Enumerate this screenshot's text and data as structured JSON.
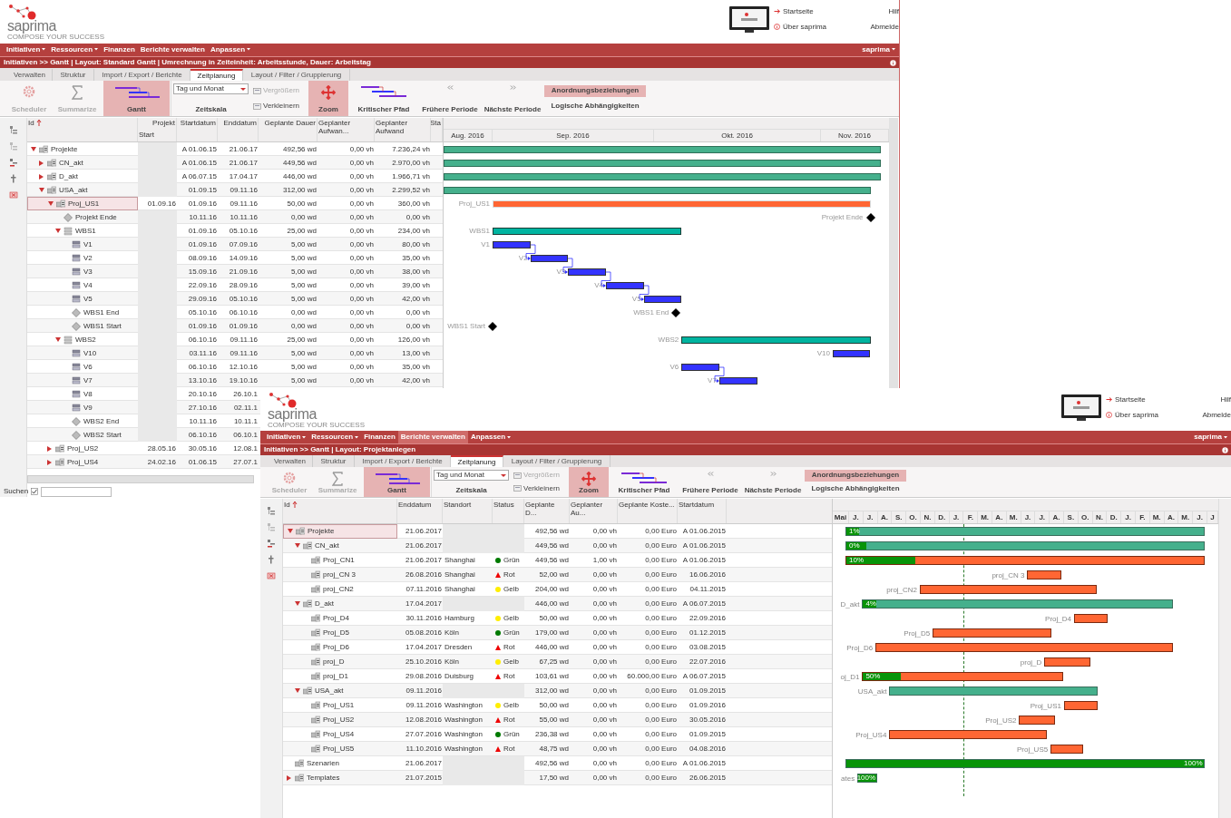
{
  "back_window": {
    "header": {
      "logo": {
        "name": "saprima",
        "tagline": "COMPOSE YOUR SUCCESS"
      },
      "links": [
        "Startseite",
        "Über saprima"
      ],
      "right_links": [
        "Hilf",
        "Abmelde"
      ]
    },
    "menu": [
      {
        "label": "Initiativen",
        "has_menu": true,
        "selected": false
      },
      {
        "label": "Ressourcen",
        "has_menu": true,
        "selected": false
      },
      {
        "label": "Finanzen",
        "has_menu": false,
        "selected": false
      },
      {
        "label": "Berichte verwalten",
        "has_menu": false,
        "selected": false
      },
      {
        "label": "Anpassen",
        "has_menu": true,
        "selected": false
      }
    ],
    "user_menu": "saprima",
    "breadcrumb": "Initiativen >> Gantt | Layout: Standard Gantt | Umrechnung in Zeiteinheit: Arbeitsstunde, Dauer: Arbeitstag",
    "tabs": [
      {
        "label": "Verwalten",
        "selected": false
      },
      {
        "label": "Struktur",
        "selected": false
      },
      {
        "label": "Import / Export / Berichte",
        "selected": false
      },
      {
        "label": "Zeitplanung",
        "selected": true
      },
      {
        "label": "Layout / Filter / Gruppierung",
        "selected": false
      }
    ],
    "ribbon": [
      {
        "kind": "large",
        "label": "Scheduler",
        "disabled": true,
        "selected": false
      },
      {
        "kind": "large",
        "label": "Summarize",
        "disabled": true,
        "selected": false
      },
      {
        "kind": "large",
        "label": "Gantt",
        "disabled": false,
        "selected": true
      },
      {
        "kind": "dropdown",
        "value": "Tag und Monat",
        "caption": "Zeitskala"
      },
      {
        "kind": "small_group",
        "buttons": [
          {
            "label": "Vergrößern",
            "disabled": true
          },
          {
            "label": "Verkleinern",
            "disabled": false
          }
        ]
      },
      {
        "kind": "large",
        "label": "Zoom",
        "disabled": false,
        "selected": true
      },
      {
        "kind": "large",
        "label": "Kritischer Pfad",
        "disabled": false,
        "selected": false
      },
      {
        "kind": "large",
        "label": "Frühere Periode",
        "disabled": false,
        "selected": false
      },
      {
        "kind": "large",
        "label": "Nächste Periode",
        "disabled": false,
        "selected": false
      },
      {
        "kind": "toggle_group",
        "buttons": [
          {
            "label": "Anordnungsbeziehungen",
            "selected": true
          },
          {
            "label": "Logische Abhängigkeiten",
            "selected": false
          }
        ]
      }
    ],
    "table": {
      "columns": [
        {
          "label": "Id",
          "sorted": true
        },
        {
          "label": "Projekt",
          "sublabel": "Start",
          "sorted": false
        },
        {
          "label": "Startdatum",
          "sorted": false
        },
        {
          "label": "Enddatum",
          "sorted": false
        },
        {
          "label": "Geplante Dauer",
          "sorted": false
        },
        {
          "label": "Geplanter Aufwan...",
          "sorted": false
        },
        {
          "label": "Geplanter Aufwand",
          "sorted": false
        },
        {
          "label": "Sta",
          "sorted": false
        }
      ],
      "rows": [
        {
          "name": "Projekte",
          "kind": "portfolio",
          "expanded": true,
          "selected": false,
          "start": "A 01.06.15",
          "end": "21.06.17",
          "duration": "492,56 wd",
          "effort_a": "0,00 vh",
          "effort_b": "7.236,24 vh",
          "children": [
            {
              "name": "CN_akt",
              "kind": "portfolio",
              "expanded": false,
              "selected": false,
              "start": "A 01.06.15",
              "end": "21.06.17",
              "duration": "449,56 wd",
              "effort_a": "0,00 vh",
              "effort_b": "2.970,00 vh"
            },
            {
              "name": "D_akt",
              "kind": "portfolio",
              "expanded": false,
              "selected": false,
              "start": "A 06.07.15",
              "end": "17.04.17",
              "duration": "446,00 wd",
              "effort_a": "0,00 vh",
              "effort_b": "1.966,71 vh"
            },
            {
              "name": "USA_akt",
              "kind": "portfolio",
              "expanded": true,
              "selected": false,
              "start": "01.09.15",
              "end": "09.11.16",
              "duration": "312,00 wd",
              "effort_a": "0,00 vh",
              "effort_b": "2.299,52 vh",
              "children": [
                {
                  "name": "Proj_US1",
                  "kind": "project",
                  "expanded": true,
                  "selected": true,
                  "bar_label": "Proj_US1",
                  "project_start": "01.09.16",
                  "start": "01.09.16",
                  "end": "09.11.16",
                  "duration": "50,00 wd",
                  "effort_a": "0,00 vh",
                  "effort_b": "360,00 vh",
                  "children": [
                    {
                      "name": "Projekt Ende",
                      "kind": "milestone",
                      "selected": false,
                      "bar_label": "Projekt Ende",
                      "start": "10.11.16",
                      "end": "10.11.16",
                      "duration": "0,00 wd",
                      "effort_a": "0,00 vh",
                      "effort_b": "0,00 vh"
                    },
                    {
                      "name": "WBS1",
                      "kind": "wbs",
                      "expanded": true,
                      "selected": false,
                      "bar_label": "WBS1",
                      "start": "01.09.16",
                      "end": "05.10.16",
                      "duration": "25,00 wd",
                      "effort_a": "0,00 vh",
                      "effort_b": "234,00 vh",
                      "children": [
                        {
                          "name": "V1",
                          "kind": "task",
                          "selected": false,
                          "bar_label": "V1",
                          "start": "01.09.16",
                          "end": "07.09.16",
                          "duration": "5,00 wd",
                          "effort_a": "0,00 vh",
                          "effort_b": "80,00 vh"
                        },
                        {
                          "name": "V2",
                          "kind": "task",
                          "selected": false,
                          "bar_label": "V2",
                          "start": "08.09.16",
                          "end": "14.09.16",
                          "duration": "5,00 wd",
                          "effort_a": "0,00 vh",
                          "effort_b": "35,00 vh"
                        },
                        {
                          "name": "V3",
                          "kind": "task",
                          "selected": false,
                          "bar_label": "V3",
                          "start": "15.09.16",
                          "end": "21.09.16",
                          "duration": "5,00 wd",
                          "effort_a": "0,00 vh",
                          "effort_b": "38,00 vh"
                        },
                        {
                          "name": "V4",
                          "kind": "task",
                          "selected": false,
                          "bar_label": "V4",
                          "start": "22.09.16",
                          "end": "28.09.16",
                          "duration": "5,00 wd",
                          "effort_a": "0,00 vh",
                          "effort_b": "39,00 vh"
                        },
                        {
                          "name": "V5",
                          "kind": "task",
                          "selected": false,
                          "bar_label": "V5",
                          "start": "29.09.16",
                          "end": "05.10.16",
                          "duration": "5,00 wd",
                          "effort_a": "0,00 vh",
                          "effort_b": "42,00 vh"
                        },
                        {
                          "name": "WBS1 End",
                          "kind": "milestone",
                          "selected": false,
                          "bar_label": "WBS1 End",
                          "start": "05.10.16",
                          "end": "06.10.16",
                          "duration": "0,00 wd",
                          "effort_a": "0,00 vh",
                          "effort_b": "0,00 vh"
                        },
                        {
                          "name": "WBS1 Start",
                          "kind": "milestone",
                          "selected": false,
                          "bar_label": "WBS1 Start",
                          "start": "01.09.16",
                          "end": "01.09.16",
                          "duration": "0,00 wd",
                          "effort_a": "0,00 vh",
                          "effort_b": "0,00 vh"
                        }
                      ]
                    },
                    {
                      "name": "WBS2",
                      "kind": "wbs",
                      "expanded": true,
                      "selected": false,
                      "bar_label": "WBS2",
                      "start": "06.10.16",
                      "end": "09.11.16",
                      "duration": "25,00 wd",
                      "effort_a": "0,00 vh",
                      "effort_b": "126,00 vh",
                      "children": [
                        {
                          "name": "V10",
                          "kind": "task",
                          "selected": false,
                          "bar_label": "V10",
                          "start": "03.11.16",
                          "end": "09.11.16",
                          "duration": "5,00 wd",
                          "effort_a": "0,00 vh",
                          "effort_b": "13,00 vh"
                        },
                        {
                          "name": "V6",
                          "kind": "task",
                          "selected": false,
                          "bar_label": "V6",
                          "start": "06.10.16",
                          "end": "12.10.16",
                          "duration": "5,00 wd",
                          "effort_a": "0,00 vh",
                          "effort_b": "35,00 vh"
                        },
                        {
                          "name": "V7",
                          "kind": "task",
                          "selected": false,
                          "bar_label": "V7",
                          "start": "13.10.16",
                          "end": "19.10.16",
                          "duration": "5,00 wd",
                          "effort_a": "0,00 vh",
                          "effort_b": "42,00 vh"
                        },
                        {
                          "name": "V8",
                          "kind": "task",
                          "selected": false,
                          "start": "20.10.16",
                          "end": "26.10.1"
                        },
                        {
                          "name": "V9",
                          "kind": "task",
                          "selected": false,
                          "start": "27.10.16",
                          "end": "02.11.1"
                        },
                        {
                          "name": "WBS2 End",
                          "kind": "milestone",
                          "selected": false,
                          "start": "10.11.16",
                          "end": "10.11.1"
                        },
                        {
                          "name": "WBS2 Start",
                          "kind": "milestone",
                          "selected": false,
                          "start": "06.10.16",
                          "end": "06.10.1"
                        }
                      ]
                    }
                  ]
                },
                {
                  "name": "Proj_US2",
                  "kind": "project",
                  "expanded": false,
                  "selected": false,
                  "project_start": "28.05.16",
                  "start": "30.05.16",
                  "end": "12.08.1"
                },
                {
                  "name": "Proj_US4",
                  "kind": "project",
                  "expanded": false,
                  "selected": false,
                  "project_start": "24.02.16",
                  "start": "01.06.15",
                  "end": "27.07.1"
                }
              ]
            }
          ]
        }
      ]
    },
    "gantt": {
      "months": [
        "Aug. 2016",
        "Sep. 2016",
        "Okt. 2016",
        "Nov. 2016"
      ]
    },
    "search": {
      "label": "Suchen",
      "checked": true
    }
  },
  "front_window": {
    "header": {
      "logo": {
        "name": "saprima",
        "tagline": "COMPOSE YOUR SUCCESS"
      },
      "links": [
        "Startseite",
        "Über saprima"
      ],
      "right_links": [
        "Hilf",
        "Abmelde"
      ]
    },
    "menu": [
      {
        "label": "Initiativen",
        "has_menu": true,
        "selected": false
      },
      {
        "label": "Ressourcen",
        "has_menu": true,
        "selected": false
      },
      {
        "label": "Finanzen",
        "has_menu": false,
        "selected": false
      },
      {
        "label": "Berichte verwalten",
        "has_menu": false,
        "selected": true
      },
      {
        "label": "Anpassen",
        "has_menu": true,
        "selected": false
      }
    ],
    "user_menu": "saprima",
    "breadcrumb": "Initiativen >> Gantt | Layout: Projektanlegen",
    "tabs": [
      {
        "label": "Verwalten",
        "selected": false
      },
      {
        "label": "Struktur",
        "selected": false
      },
      {
        "label": "Import / Export / Berichte",
        "selected": false
      },
      {
        "label": "Zeitplanung",
        "selected": true
      },
      {
        "label": "Layout / Filter / Gruppierung",
        "selected": false
      }
    ],
    "ribbon": [
      {
        "kind": "large",
        "label": "Scheduler",
        "disabled": true,
        "selected": false
      },
      {
        "kind": "large",
        "label": "Summarize",
        "disabled": true,
        "selected": false
      },
      {
        "kind": "large",
        "label": "Gantt",
        "disabled": false,
        "selected": true
      },
      {
        "kind": "dropdown",
        "value": "Tag und Monat",
        "caption": "Zeitskala"
      },
      {
        "kind": "small_group",
        "buttons": [
          {
            "label": "Vergrößern",
            "disabled": true
          },
          {
            "label": "Verkleinern",
            "disabled": false
          }
        ]
      },
      {
        "kind": "large",
        "label": "Zoom",
        "disabled": false,
        "selected": true
      },
      {
        "kind": "large",
        "label": "Kritischer Pfad",
        "disabled": false,
        "selected": false
      },
      {
        "kind": "large",
        "label": "Frühere Periode",
        "disabled": false,
        "selected": false
      },
      {
        "kind": "large",
        "label": "Nächste Periode",
        "disabled": false,
        "selected": false
      },
      {
        "kind": "toggle_group",
        "buttons": [
          {
            "label": "Anordnungsbeziehungen",
            "selected": true
          },
          {
            "label": "Logische Abhängigkeiten",
            "selected": false
          }
        ]
      }
    ],
    "table": {
      "columns": [
        {
          "label": "Id",
          "sorted": true
        },
        {
          "label": "Enddatum",
          "sorted": false
        },
        {
          "label": "Standort",
          "sorted": false
        },
        {
          "label": "Status",
          "sorted": false
        },
        {
          "label": "Geplante D...",
          "sorted": false
        },
        {
          "label": "Geplanter Au...",
          "sorted": false
        },
        {
          "label": "Geplante Koste...",
          "sorted": false
        },
        {
          "label": "Startdatum",
          "sorted": false
        }
      ],
      "rows": [
        {
          "name": "Projekte",
          "kind": "portfolio",
          "expanded": true,
          "selected": true,
          "level": 0.035,
          "progress_label": "1%",
          "end": "21.06.2017",
          "duration": "492,56 wd",
          "effort": "0,00 vh",
          "cost": "0,00 Euro",
          "start": "A 01.06.2015",
          "children": [
            {
              "name": "CN_akt",
              "kind": "portfolio",
              "expanded": true,
              "selected": false,
              "level": 0.057,
              "progress_label": "0%",
              "end": "21.06.2017",
              "duration": "449,56 wd",
              "effort": "0,00 vh",
              "cost": "0,00 Euro",
              "start": "A 01.06.2015",
              "children": [
                {
                  "name": "Proj_CN1",
                  "kind": "project",
                  "selected": false,
                  "level": 0.194,
                  "progress_label": "10%",
                  "end": "21.06.2017",
                  "location": "Shanghai",
                  "status": {
                    "label": "Grün",
                    "kind": "dot",
                    "color": "#007a00"
                  },
                  "duration": "449,56 wd",
                  "effort": "1,00 vh",
                  "cost": "0,00 Euro",
                  "start": "A 01.06.2015"
                },
                {
                  "name": "proj_CN 3",
                  "kind": "project",
                  "selected": false,
                  "bar_label": "proj_CN 3",
                  "end": "26.08.2016",
                  "location": "Shanghai",
                  "status": {
                    "label": "Rot",
                    "kind": "triangle",
                    "color": "#ee0000"
                  },
                  "duration": "52,00 wd",
                  "effort": "0,00 vh",
                  "cost": "0,00 Euro",
                  "start": "16.06.2016"
                },
                {
                  "name": "proj_CN2",
                  "kind": "project",
                  "selected": false,
                  "bar_label": "proj_CN2",
                  "end": "07.11.2016",
                  "location": "Shanghai",
                  "status": {
                    "label": "Gelb",
                    "kind": "dot",
                    "color": "#ffee00"
                  },
                  "duration": "204,00 wd",
                  "effort": "0,00 vh",
                  "cost": "0,00 Euro",
                  "start": "04.11.2015"
                }
              ]
            },
            {
              "name": "D_akt",
              "kind": "portfolio",
              "expanded": true,
              "selected": false,
              "bar_label": "D_akt",
              "level": 0.044,
              "progress_label": "4%",
              "end": "17.04.2017",
              "duration": "446,00 wd",
              "effort": "0,00 vh",
              "cost": "0,00 Euro",
              "start": "A 06.07.2015",
              "children": [
                {
                  "name": "Proj_D4",
                  "kind": "project",
                  "selected": false,
                  "bar_label": "Proj_D4",
                  "end": "30.11.2016",
                  "location": "Hamburg",
                  "status": {
                    "label": "Gelb",
                    "kind": "dot",
                    "color": "#ffee00"
                  },
                  "duration": "50,00 wd",
                  "effort": "0,00 vh",
                  "cost": "0,00 Euro",
                  "start": "22.09.2016"
                },
                {
                  "name": "Proj_D5",
                  "kind": "project",
                  "selected": false,
                  "bar_label": "Proj_D5",
                  "end": "05.08.2016",
                  "location": "Köln",
                  "status": {
                    "label": "Grün",
                    "kind": "dot",
                    "color": "#007a00"
                  },
                  "duration": "179,00 wd",
                  "effort": "0,00 vh",
                  "cost": "0,00 Euro",
                  "start": "01.12.2015"
                },
                {
                  "name": "Proj_D6",
                  "kind": "project",
                  "selected": false,
                  "bar_label": "Proj_D6",
                  "end": "17.04.2017",
                  "location": "Dresden",
                  "status": {
                    "label": "Rot",
                    "kind": "triangle",
                    "color": "#ee0000"
                  },
                  "duration": "446,00 wd",
                  "effort": "0,00 vh",
                  "cost": "0,00 Euro",
                  "start": "03.08.2015"
                },
                {
                  "name": "proj_D",
                  "kind": "project",
                  "selected": false,
                  "bar_label": "proj_D",
                  "end": "25.10.2016",
                  "location": "Köln",
                  "status": {
                    "label": "Gelb",
                    "kind": "dot",
                    "color": "#ffee00"
                  },
                  "duration": "67,25 wd",
                  "effort": "0,00 vh",
                  "cost": "0,00 Euro",
                  "start": "22.07.2016"
                },
                {
                  "name": "proj_D1",
                  "kind": "project",
                  "selected": false,
                  "bar_label": "oj_D1",
                  "level": 0.19,
                  "progress_label": "50%",
                  "end": "29.08.2016",
                  "location": "Duisburg",
                  "status": {
                    "label": "Rot",
                    "kind": "triangle",
                    "color": "#ee0000"
                  },
                  "duration": "103,61 wd",
                  "effort": "0,00 vh",
                  "cost": "60.000,00 Euro",
                  "start": "A 06.07.2015"
                }
              ]
            },
            {
              "name": "USA_akt",
              "kind": "portfolio",
              "expanded": true,
              "selected": false,
              "bar_label": "USA_akt",
              "end": "09.11.2016",
              "duration": "312,00 wd",
              "effort": "0,00 vh",
              "cost": "0,00 Euro",
              "start": "01.09.2015",
              "children": [
                {
                  "name": "Proj_US1",
                  "kind": "project",
                  "selected": false,
                  "bar_label": "Proj_US1",
                  "end": "09.11.2016",
                  "location": "Washington",
                  "status": {
                    "label": "Gelb",
                    "kind": "dot",
                    "color": "#ffee00"
                  },
                  "duration": "50,00 wd",
                  "effort": "0,00 vh",
                  "cost": "0,00 Euro",
                  "start": "01.09.2016"
                },
                {
                  "name": "Proj_US2",
                  "kind": "project",
                  "selected": false,
                  "bar_label": "Proj_US2",
                  "end": "12.08.2016",
                  "location": "Washington",
                  "status": {
                    "label": "Rot",
                    "kind": "triangle",
                    "color": "#ee0000"
                  },
                  "duration": "55,00 wd",
                  "effort": "0,00 vh",
                  "cost": "0,00 Euro",
                  "start": "30.05.2016"
                },
                {
                  "name": "Proj_US4",
                  "kind": "project",
                  "selected": false,
                  "bar_label": "Proj_US4",
                  "end": "27.07.2016",
                  "location": "Washington",
                  "status": {
                    "label": "Grün",
                    "kind": "dot",
                    "color": "#007a00"
                  },
                  "duration": "236,38 wd",
                  "effort": "0,00 vh",
                  "cost": "0,00 Euro",
                  "start": "01.09.2015"
                },
                {
                  "name": "Proj_US5",
                  "kind": "project",
                  "selected": false,
                  "bar_label": "Proj_US5",
                  "end": "11.10.2016",
                  "location": "Washington",
                  "status": {
                    "label": "Rot",
                    "kind": "triangle",
                    "color": "#ee0000"
                  },
                  "duration": "48,75 wd",
                  "effort": "0,00 vh",
                  "cost": "0,00 Euro",
                  "start": "04.08.2016"
                }
              ]
            }
          ]
        },
        {
          "name": "Szenarien",
          "kind": "portfolio",
          "selected": false,
          "level": 1,
          "progress_label": "100%",
          "end": "21.06.2017",
          "duration": "492,56 wd",
          "effort": "0,00 vh",
          "cost": "0,00 Euro",
          "start": "A 01.06.2015"
        },
        {
          "name": "Templates",
          "kind": "portfolio",
          "expanded": false,
          "selected": false,
          "bar_label": "ates",
          "level": 1,
          "progress_label": "100%",
          "end": "21.07.2015",
          "duration": "17,50 wd",
          "effort": "0,00 vh",
          "cost": "0,00 Euro",
          "start": "26.06.2015"
        }
      ]
    },
    "gantt": {
      "months": [
        "Mai",
        "J.",
        "J.",
        "A.",
        "S.",
        "O.",
        "N.",
        "D.",
        "J.",
        "F.",
        "M.",
        "A.",
        "M.",
        "J.",
        "J.",
        "A.",
        "S.",
        "O.",
        "N.",
        "D.",
        "J.",
        "F.",
        "M.",
        "A.",
        "M.",
        "J.",
        "J"
      ]
    }
  }
}
